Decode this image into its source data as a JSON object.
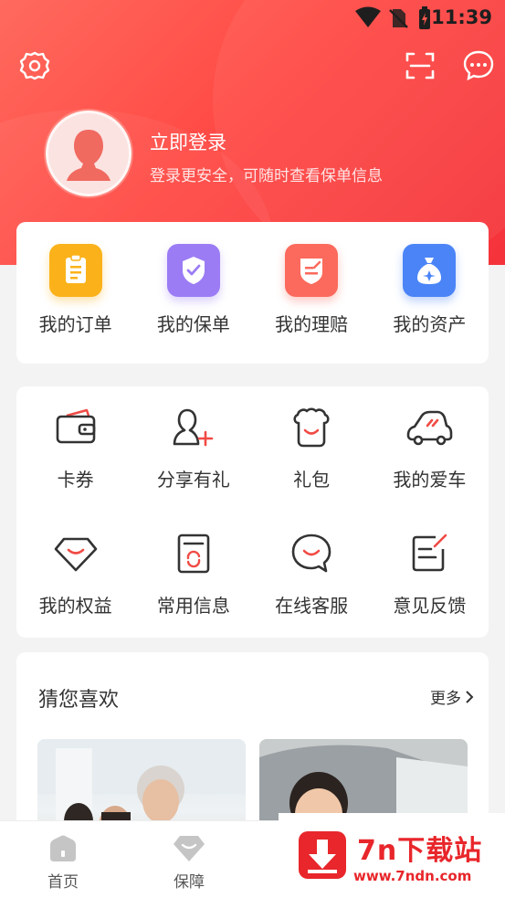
{
  "status_bar": {
    "time": "11:39",
    "icons": [
      "wifi-icon",
      "no-sim-icon",
      "battery-charging-icon"
    ]
  },
  "header": {
    "left_icon": "settings-icon",
    "right_icons": [
      "scan-icon",
      "message-icon"
    ]
  },
  "profile": {
    "title": "立即登录",
    "subtitle": "登录更安全，可随时查看保单信息"
  },
  "quick_links": [
    {
      "label": "我的订单",
      "icon": "clipboard-icon",
      "color": "#fbb21a"
    },
    {
      "label": "我的保单",
      "icon": "shield-check-icon",
      "color": "#9b7cf4"
    },
    {
      "label": "我的理赔",
      "icon": "claim-shield-icon",
      "color": "#fb6a5c"
    },
    {
      "label": "我的资产",
      "icon": "money-bag-icon",
      "color": "#4a84f7"
    }
  ],
  "services": [
    {
      "label": "卡券",
      "icon": "wallet-icon"
    },
    {
      "label": "分享有礼",
      "icon": "add-user-icon"
    },
    {
      "label": "礼包",
      "icon": "gift-pot-icon"
    },
    {
      "label": "我的爱车",
      "icon": "car-icon"
    },
    {
      "label": "我的权益",
      "icon": "diamond-icon"
    },
    {
      "label": "常用信息",
      "icon": "document-refresh-icon"
    },
    {
      "label": "在线客服",
      "icon": "chat-smile-icon"
    },
    {
      "label": "意见反馈",
      "icon": "feedback-edit-icon"
    }
  ],
  "recommend": {
    "title": "猜您喜欢",
    "more": "更多"
  },
  "tabs": [
    {
      "label": "首页",
      "icon": "home-icon"
    },
    {
      "label": "保障",
      "icon": "diamond-icon"
    }
  ],
  "watermark": {
    "title": "7n下载站",
    "url": "www.7ndn.com"
  },
  "colors": {
    "brand_red": "#f4333a",
    "watermark_red": "#e8262b",
    "accent_red": "#f04b45"
  }
}
